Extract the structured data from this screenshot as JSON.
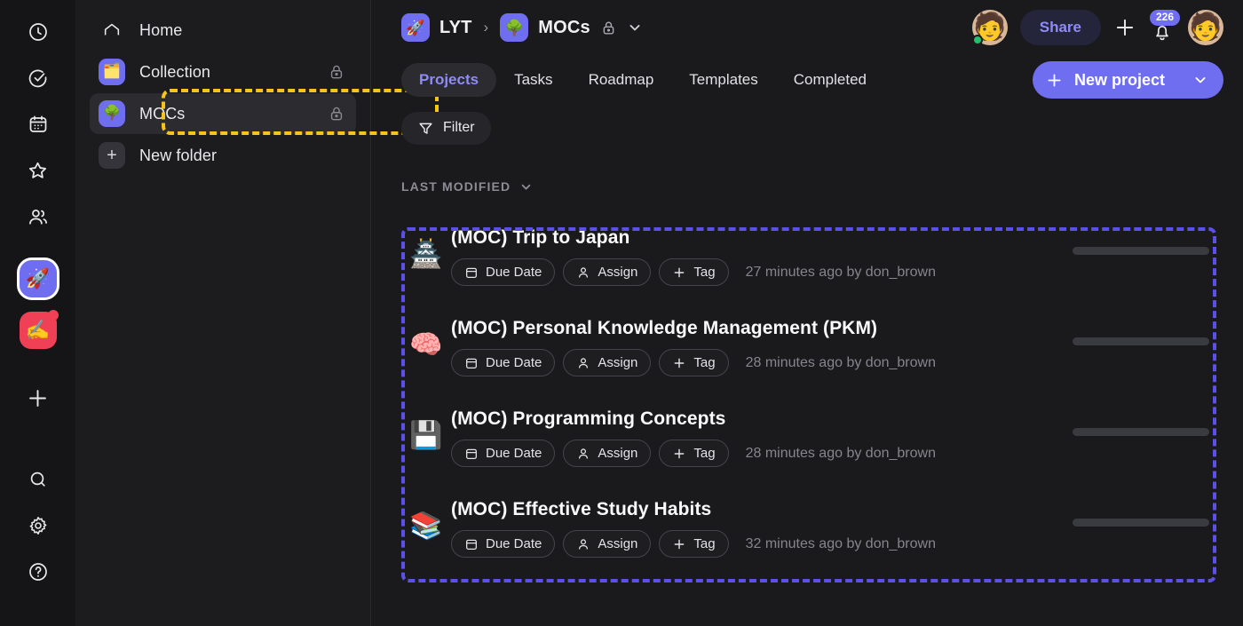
{
  "rail": {
    "items": [
      {
        "name": "clock-icon",
        "label": "Recent"
      },
      {
        "name": "check-circle-icon",
        "label": "Tasks"
      },
      {
        "name": "calendar-icon",
        "label": "Calendar"
      },
      {
        "name": "star-icon",
        "label": "Favorites"
      },
      {
        "name": "people-icon",
        "label": "People"
      }
    ],
    "workspaces": [
      {
        "emoji": "🚀",
        "color": "#6f6ef0",
        "active": true,
        "badge": false,
        "label": "LYT"
      },
      {
        "emoji": "✍️",
        "color": "#ef4056",
        "active": false,
        "badge": true,
        "label": "Writing"
      }
    ],
    "add_label": "+",
    "bottom": [
      {
        "name": "search-icon",
        "label": "Search"
      },
      {
        "name": "gear-icon",
        "label": "Settings"
      },
      {
        "name": "help-icon",
        "label": "Help"
      }
    ]
  },
  "sidebar": {
    "items": [
      {
        "label": "Home",
        "icon": "home-icon",
        "icon_style": "plain",
        "emoji": "",
        "locked": false,
        "selected": false
      },
      {
        "label": "Collection",
        "icon": "folder-icon",
        "icon_style": "blue",
        "emoji": "🗂️",
        "locked": true,
        "selected": false
      },
      {
        "label": "MOCs",
        "icon": "tree-icon",
        "icon_style": "blue",
        "emoji": "🌳",
        "locked": true,
        "selected": true
      },
      {
        "label": "New folder",
        "icon": "plus-icon",
        "icon_style": "gray",
        "emoji": "+",
        "locked": false,
        "selected": false
      }
    ]
  },
  "header": {
    "breadcrumb": [
      {
        "label": "LYT",
        "emoji": "🚀"
      },
      {
        "label": "MOCs",
        "emoji": "🌳"
      }
    ],
    "separator": "›",
    "share_label": "Share",
    "notification_count": "226",
    "avatar_emoji": "🧑",
    "user_avatar_emoji": "🧑"
  },
  "tabs": [
    {
      "label": "Projects",
      "active": true
    },
    {
      "label": "Tasks",
      "active": false
    },
    {
      "label": "Roadmap",
      "active": false
    },
    {
      "label": "Templates",
      "active": false
    },
    {
      "label": "Completed",
      "active": false
    }
  ],
  "toolbar": {
    "new_project_label": "New project",
    "filter_label": "Filter"
  },
  "section": {
    "sort_label": "LAST MODIFIED"
  },
  "chip_labels": {
    "due_date": "Due Date",
    "assign": "Assign",
    "tag": "Tag"
  },
  "projects": [
    {
      "emoji": "🏯",
      "title": "(MOC) Trip to Japan",
      "meta": "27 minutes ago by don_brown"
    },
    {
      "emoji": "🧠",
      "title": "(MOC) Personal Knowledge Management (PKM)",
      "meta": "28 minutes ago by don_brown"
    },
    {
      "emoji": "💾",
      "title": "(MOC) Programming Concepts",
      "meta": "28 minutes ago by don_brown"
    },
    {
      "emoji": "📚",
      "title": "(MOC) Effective Study Habits",
      "meta": "32 minutes ago by don_brown"
    }
  ],
  "annotations": {
    "sidebar_highlight_color": "#f5c518",
    "list_highlight_color": "#5b51e8"
  },
  "colors": {
    "accent": "#6f6ef0",
    "accent_text": "#8f8bfa",
    "background": "#1a1a1c",
    "sidebar_bg": "#1c1c1f",
    "rail_bg": "#151517"
  }
}
